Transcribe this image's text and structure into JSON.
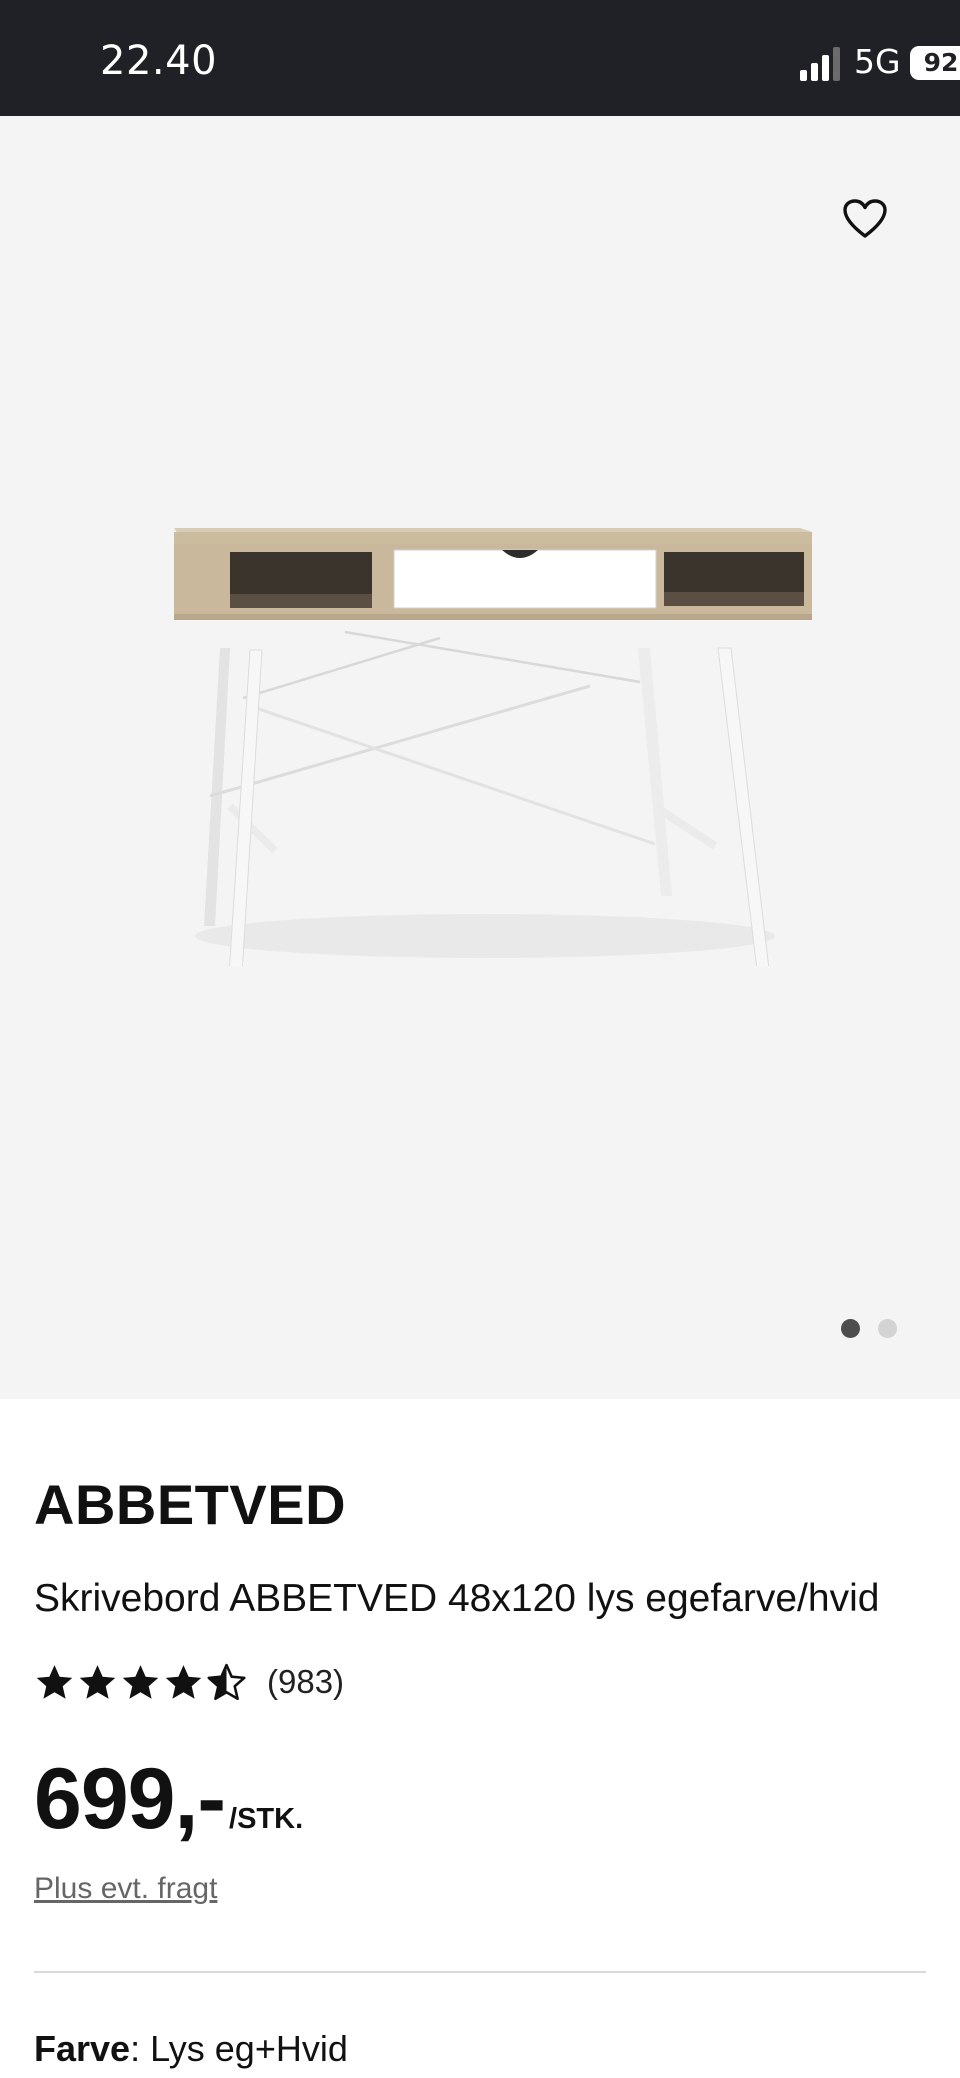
{
  "status_bar": {
    "time": "22.40",
    "network": "5G",
    "battery": "92"
  },
  "gallery": {
    "image_alt": "Skrivebord ABBETVED 48x120 lys egefarve/hvid",
    "dot_count": 2,
    "active_dot": 1
  },
  "product": {
    "brand": "ABBETVED",
    "description": "Skrivebord ABBETVED 48x120 lys egefarve/hvid",
    "rating": 4.5,
    "review_count": "(983)",
    "price": "699,-",
    "price_unit": "/STK.",
    "shipping_link": "Plus evt. fragt"
  },
  "color": {
    "label": "Farve",
    "value": "Lys eg+Hvid"
  },
  "icons": [
    "signal-icon",
    "heart-icon",
    "star-icon",
    "half-star-icon"
  ]
}
